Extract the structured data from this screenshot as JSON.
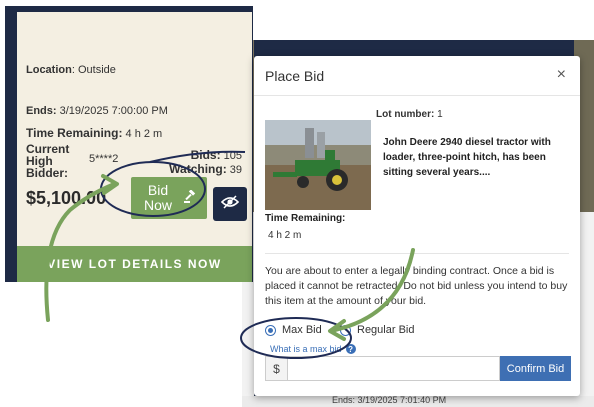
{
  "listing_card": {
    "location_label": "Location",
    "location_value": "Outside",
    "ends_label": "Ends:",
    "ends_value": "3/19/2025 7:00:00 PM",
    "time_remaining_label": "Time Remaining:",
    "time_remaining_value": "4 h  2 m",
    "bids_label": "Bids:",
    "bids_value": "105",
    "watching_label": "Watching:",
    "watching_value": "39",
    "current_high_bidder_label": "Current High Bidder:",
    "current_high_bidder_value": "5****2",
    "price": "$5,100.00",
    "bid_now_label": "Bid Now",
    "view_lot_label": "VIEW LOT DETAILS NOW"
  },
  "modal": {
    "title": "Place Bid",
    "close_label": "×",
    "lot_number_label": "Lot number:",
    "lot_number_value": "1",
    "description": "John Deere 2940 diesel tractor with loader, three-point hitch, has been sitting several years....",
    "time_remaining_label": "Time Remaining:",
    "time_remaining_value": "4 h  2 m",
    "warning": "You are about to enter a legally binding contract. Once a bid is placed it cannot be retracted. Do not bid unless you intend to buy this item at the amount of your bid.",
    "max_bid_label": "Max Bid",
    "regular_bid_label": "Regular Bid",
    "help_link": "What is a max bid",
    "currency_symbol": "$",
    "amount_value": "",
    "confirm_label": "Confirm Bid"
  },
  "background": {
    "ends_partial": "Ends: 3/19/2025 7:01:40 PM"
  },
  "colors": {
    "accent_green": "#7aa35c",
    "navy": "#1e2a45",
    "link_blue": "#3a6fb7",
    "confirm_blue": "#3e6fb3",
    "annotation_navy": "#1f2b55"
  },
  "icons": [
    "gavel-icon",
    "eye-icon",
    "close-icon",
    "help-icon",
    "radio-icon"
  ]
}
